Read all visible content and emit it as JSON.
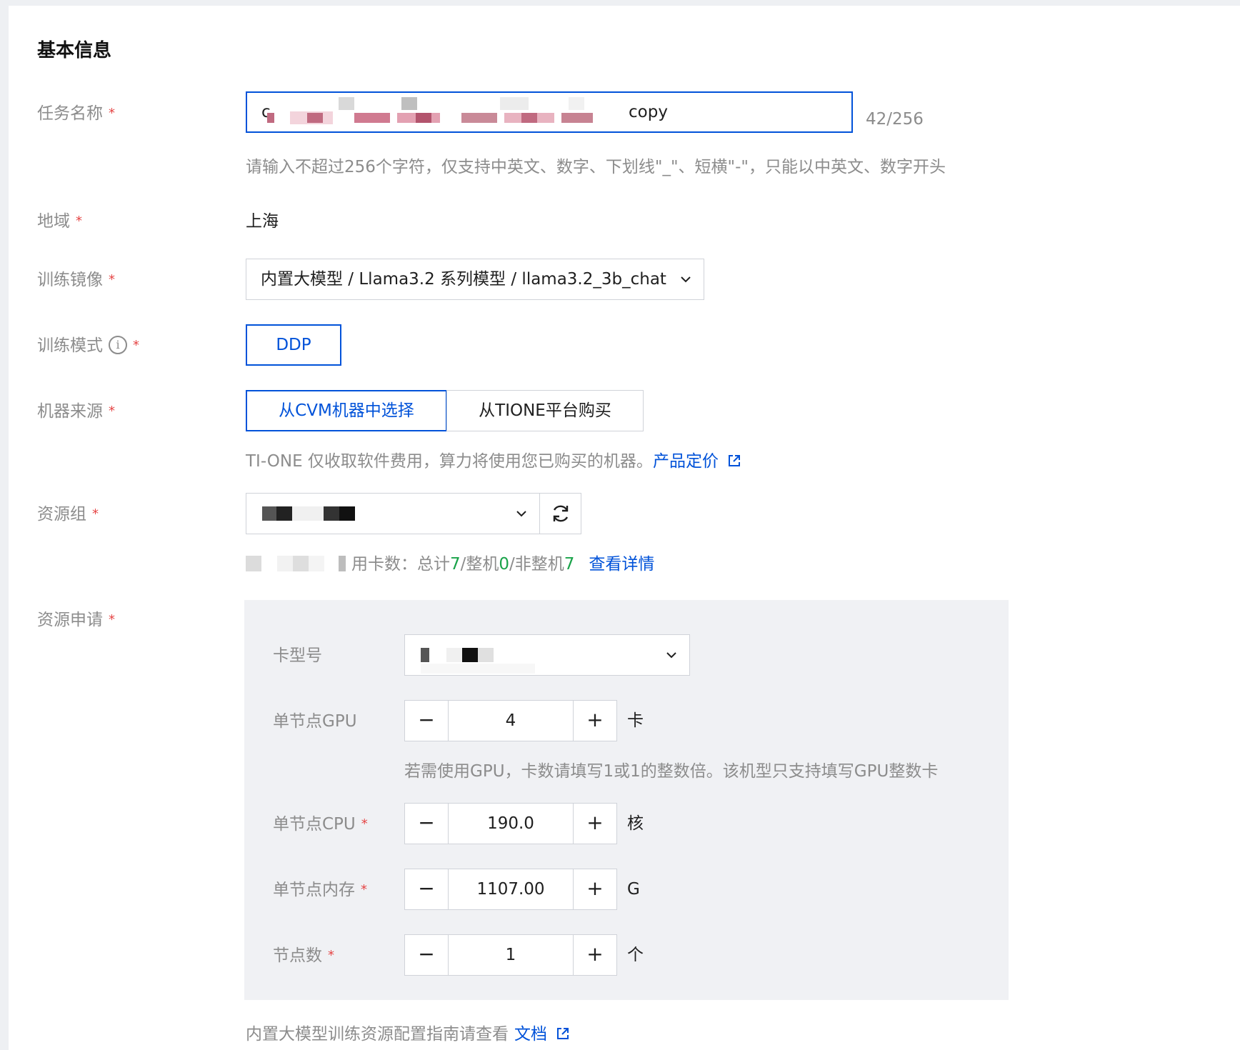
{
  "section": {
    "title": "基本信息"
  },
  "task_name": {
    "label": "任务名称",
    "value_start": "c",
    "value_end": "copy",
    "counter": "42/256",
    "hint": "请输入不超过256个字符，仅支持中英文、数字、下划线\"_\"、短横\"-\"，只能以中英文、数字开头"
  },
  "region": {
    "label": "地域",
    "value": "上海"
  },
  "image": {
    "label": "训练镜像",
    "value": "内置大模型 / Llama3.2 系列模型 / llama3.2_3b_chat"
  },
  "mode": {
    "label": "训练模式",
    "option": "DDP"
  },
  "source": {
    "label": "机器来源",
    "options": [
      "从CVM机器中选择",
      "从TIONE平台购买"
    ],
    "hint": "TI-ONE 仅收取软件费用，算力将使用您已购买的机器。",
    "link": "产品定价"
  },
  "resource_group": {
    "label": "资源组",
    "avail_prefix": "用卡数：总计",
    "total": "7",
    "sep1": "/整机",
    "whole": "0",
    "sep2": "/非整机",
    "partial": "7",
    "link": "查看详情"
  },
  "resource_request": {
    "label": "资源申请",
    "card_type_label": "卡型号",
    "gpu": {
      "label": "单节点GPU",
      "value": "4",
      "unit": "卡",
      "hint": "若需使用GPU，卡数请填写1或1的整数倍。该机型只支持填写GPU整数卡"
    },
    "cpu": {
      "label": "单节点CPU",
      "value": "190.0",
      "unit": "核"
    },
    "mem": {
      "label": "单节点内存",
      "value": "1107.00",
      "unit": "G"
    },
    "nodes": {
      "label": "节点数",
      "value": "1",
      "unit": "个"
    },
    "minus": "−",
    "plus": "+"
  },
  "footer": {
    "hint": "内置大模型训练资源配置指南请查看",
    "link": "文档"
  },
  "icons": {
    "info": "info-icon",
    "external": "external-link-icon",
    "chevron": "chevron-down-icon",
    "refresh": "refresh-icon"
  },
  "colors": {
    "primary": "#0052d9",
    "required": "#e54545",
    "success": "#1aa34a",
    "panel": "#f0f1f4"
  }
}
